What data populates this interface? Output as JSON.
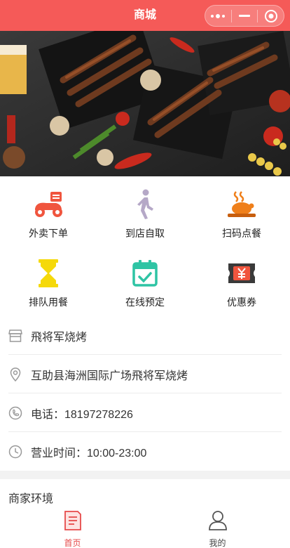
{
  "navbar": {
    "title": "商城",
    "bg": "#f55a58"
  },
  "capsule": {
    "more_icon": "more-dots-icon",
    "minimize_icon": "minimize-icon",
    "close_icon": "target-close-icon"
  },
  "banner": {
    "image": "bbq-skewers-photo"
  },
  "services": [
    {
      "label": "外卖下单",
      "icon": "delivery-scooter-icon",
      "color": "#f0553e"
    },
    {
      "label": "到店自取",
      "icon": "walking-person-icon",
      "color": "#b5a8c7"
    },
    {
      "label": "扫码点餐",
      "icon": "roast-chicken-icon",
      "color": "#ef7f1a"
    },
    {
      "label": "排队用餐",
      "icon": "hourglass-icon",
      "color": "#f5d90a"
    },
    {
      "label": "在线预定",
      "icon": "calendar-check-icon",
      "color": "#2ec4a4"
    },
    {
      "label": "优惠券",
      "icon": "coupon-yen-icon",
      "color": "#f0553e"
    }
  ],
  "store": {
    "name": "飛将军烧烤",
    "address": "互助县海洲国际广场飛将军烧烤",
    "phone": "电话：18197278226",
    "hours": "营业时间：10:00-23:00"
  },
  "environment_title": "商家环境",
  "tabs": [
    {
      "label": "首页",
      "icon": "home-document-icon",
      "active": true
    },
    {
      "label": "我的",
      "icon": "user-profile-icon",
      "active": false
    }
  ]
}
